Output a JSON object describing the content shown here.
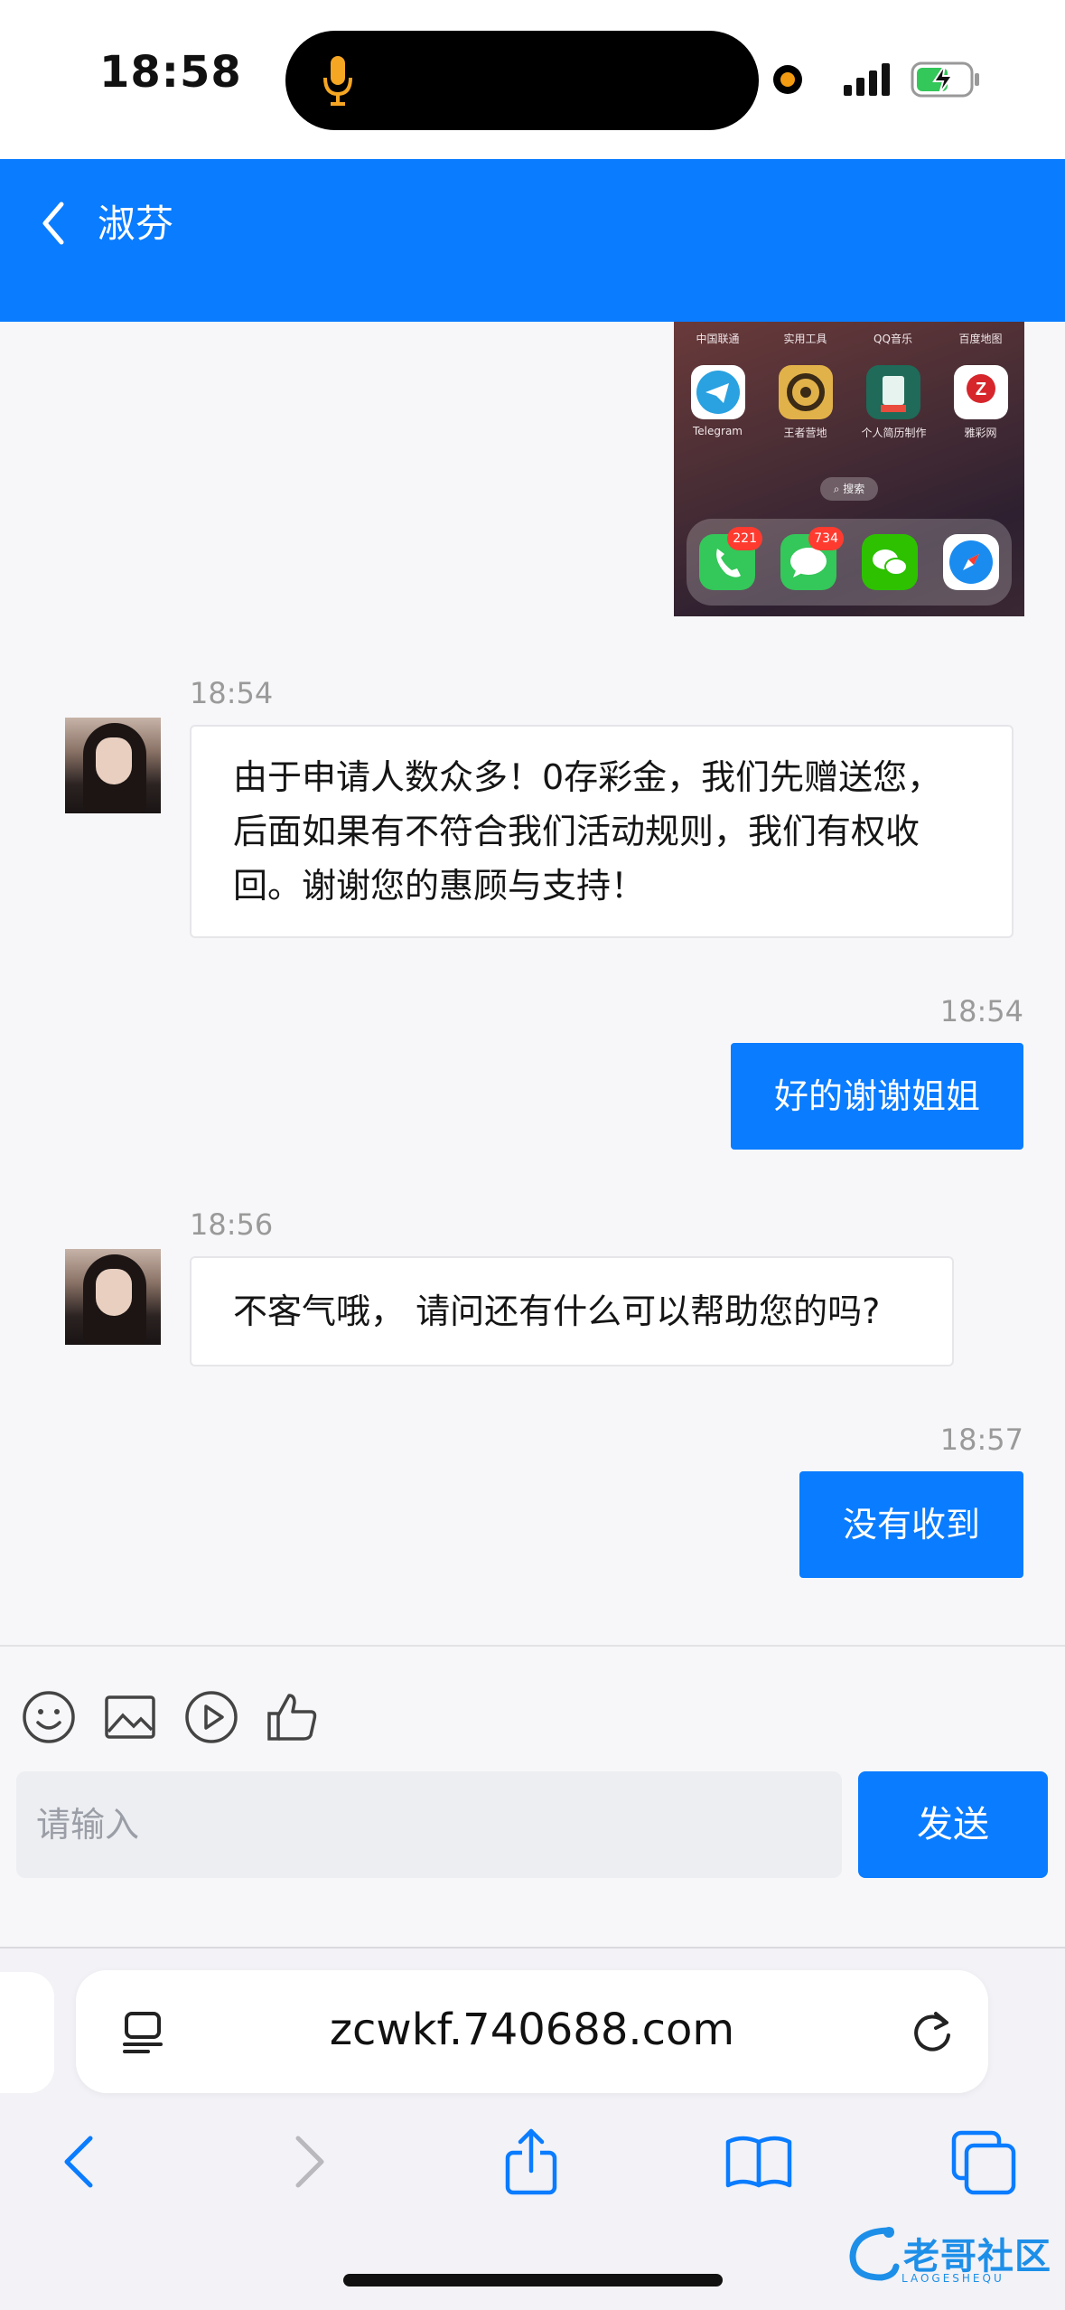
{
  "status_bar": {
    "time": "18:58"
  },
  "header": {
    "title": "淑芬"
  },
  "shared_image": {
    "top_row_labels": [
      "中国联通",
      "实用工具",
      "QQ音乐",
      "百度地图"
    ],
    "apps": [
      {
        "label": "Telegram",
        "icon": "telegram-icon"
      },
      {
        "label": "王者营地",
        "icon": "game-camp-icon"
      },
      {
        "label": "个人简历制作",
        "icon": "resume-icon"
      },
      {
        "label": "雅彩网",
        "icon": "lottery-icon"
      }
    ],
    "search_label": "搜索",
    "dock": [
      {
        "icon": "phone-icon",
        "badge": "221"
      },
      {
        "icon": "messages-icon",
        "badge": "734"
      },
      {
        "icon": "wechat-icon",
        "badge": ""
      },
      {
        "icon": "safari-icon",
        "badge": ""
      }
    ]
  },
  "messages": [
    {
      "side": "left",
      "time": "18:54",
      "text": "由于申请人数众多！0存彩金，我们先赠送您，后面如果有不符合我们活动规则，我们有权收回。谢谢您的惠顾与支持！"
    },
    {
      "side": "right",
      "time": "18:54",
      "text": "好的谢谢姐姐"
    },
    {
      "side": "left",
      "time": "18:56",
      "text": "不客气哦， 请问还有什么可以帮助您的吗?"
    },
    {
      "side": "right",
      "time": "18:57",
      "text": "没有收到"
    }
  ],
  "composer": {
    "tools": [
      "emoji-icon",
      "image-icon",
      "video-icon",
      "thumbs-up-icon"
    ],
    "placeholder": "请输入",
    "send_label": "发送"
  },
  "browser": {
    "url": "zcwkf.740688.com",
    "nav": [
      "back-icon",
      "forward-icon",
      "share-icon",
      "bookmarks-icon",
      "tabs-icon"
    ]
  },
  "watermark": {
    "text": "老哥社区",
    "sub": "LAOGESHEQU"
  },
  "colors": {
    "accent": "#0a7cff",
    "background": "#f7f7f9"
  }
}
